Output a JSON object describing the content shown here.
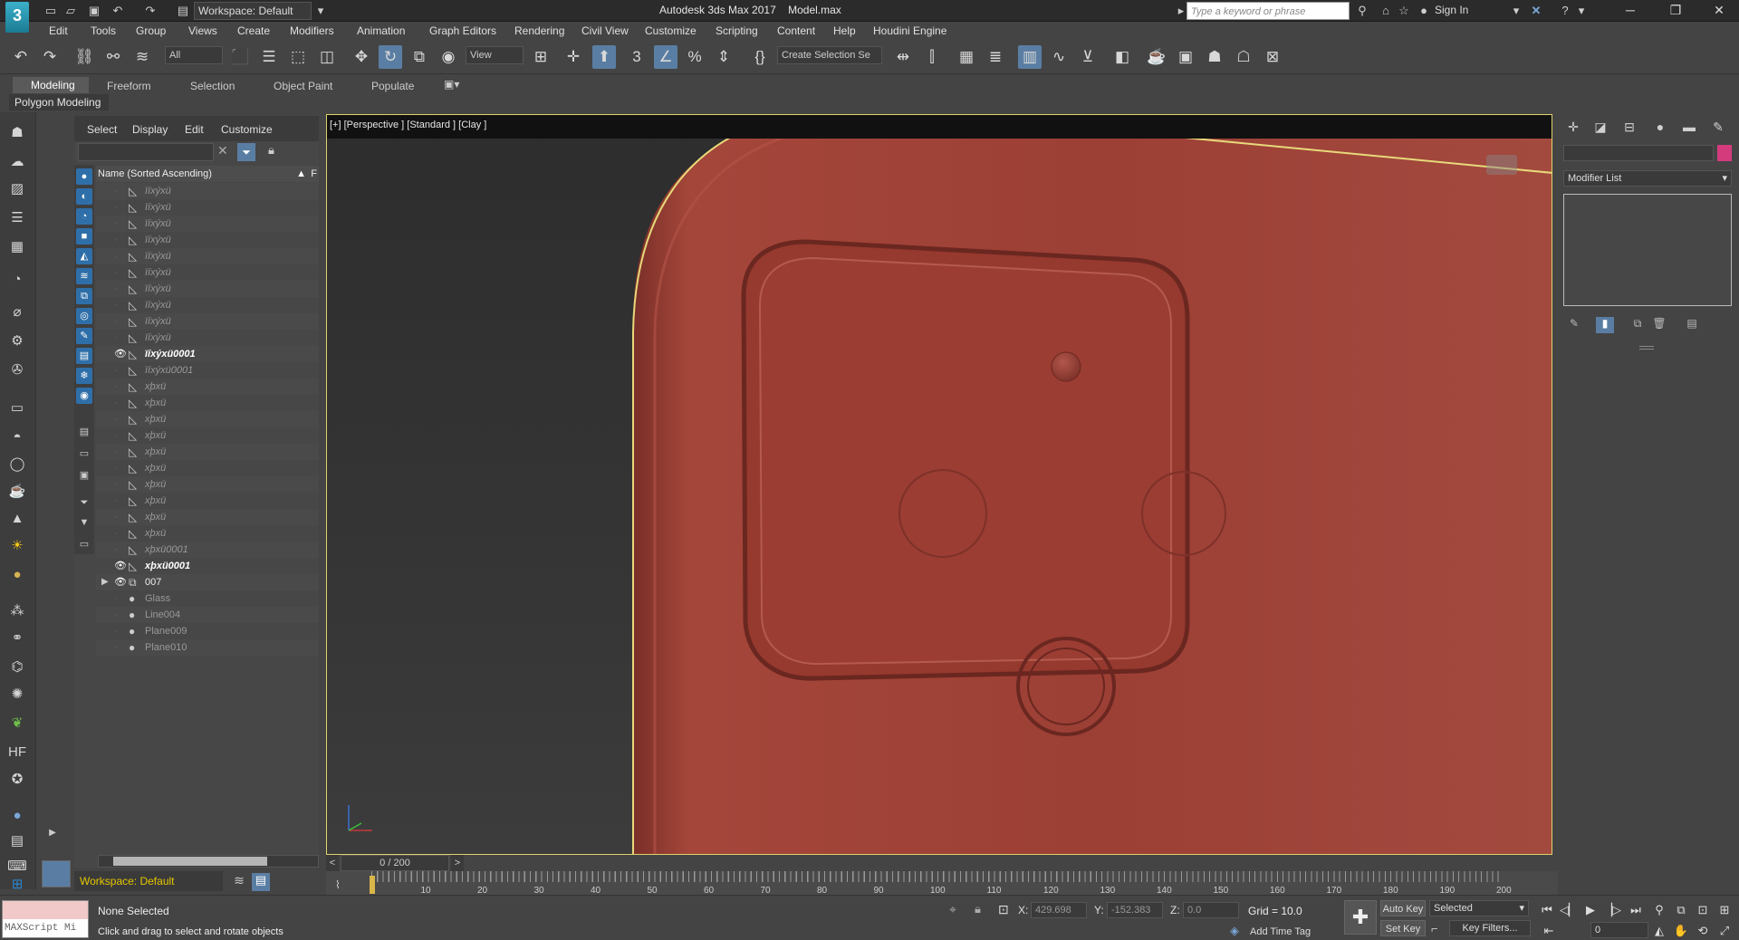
{
  "app": {
    "title": "Autodesk 3ds Max 2017",
    "file": "Model.max",
    "workspace": "Workspace: Default",
    "search_placeholder": "Type a keyword or phrase",
    "signin": "Sign In"
  },
  "menu": [
    "Edit",
    "Tools",
    "Group",
    "Views",
    "Create",
    "Modifiers",
    "Animation",
    "Graph Editors",
    "Rendering",
    "Civil View",
    "Customize",
    "Scripting",
    "Content",
    "Help",
    "Houdini Engine"
  ],
  "toolbar": {
    "selection_filter": "All",
    "reference_coord": "View",
    "named_selection": "Create Selection Se"
  },
  "ribbon": {
    "tabs": [
      "Modeling",
      "Freeform",
      "Selection",
      "Object Paint",
      "Populate"
    ],
    "panel": "Polygon Modeling"
  },
  "explorer": {
    "menu": [
      "Select",
      "Display",
      "Edit",
      "Customize"
    ],
    "column_header": "Name (Sorted Ascending)",
    "column_flag": "F",
    "rows": [
      {
        "label": "ïíxýxü",
        "visible": false
      },
      {
        "label": "ïíxýxü",
        "visible": false
      },
      {
        "label": "ïíxýxü",
        "visible": false
      },
      {
        "label": "ïíxýxü",
        "visible": false
      },
      {
        "label": "ïíxýxü",
        "visible": false
      },
      {
        "label": "ïíxýxü",
        "visible": false
      },
      {
        "label": "ïíxýxü",
        "visible": false
      },
      {
        "label": "ïíxýxü",
        "visible": false
      },
      {
        "label": "ïíxýxü",
        "visible": false
      },
      {
        "label": "ïíxýxü",
        "visible": false
      },
      {
        "label": "ïíxýxü0001",
        "visible": true
      },
      {
        "label": "ïíxýxü0001",
        "visible": false
      },
      {
        "label": "xþxü",
        "visible": false
      },
      {
        "label": "xþxü",
        "visible": false
      },
      {
        "label": "xþxü",
        "visible": false
      },
      {
        "label": "xþxü",
        "visible": false
      },
      {
        "label": "xþxü",
        "visible": false
      },
      {
        "label": "xþxü",
        "visible": false
      },
      {
        "label": "xþxü",
        "visible": false
      },
      {
        "label": "xþxü",
        "visible": false
      },
      {
        "label": "xþxü",
        "visible": false
      },
      {
        "label": "xþxü",
        "visible": false
      },
      {
        "label": "xþxü0001",
        "visible": false
      },
      {
        "label": "xþxü0001",
        "visible": true
      },
      {
        "label": "007",
        "visible": true,
        "group": true
      },
      {
        "label": "Glass",
        "visible": false,
        "plain": true
      },
      {
        "label": "Line004",
        "visible": false,
        "plain": true
      },
      {
        "label": "Plane009",
        "visible": false,
        "plain": true
      },
      {
        "label": "Plane010",
        "visible": false,
        "plain": true
      }
    ],
    "workspace": "Workspace: Default"
  },
  "viewport": {
    "label": "[+] [Perspective ] [Standard ] [Clay ]",
    "model_color": "#9c3f35",
    "selection_color": "#e3d27a"
  },
  "command_panel": {
    "modifier_list": "Modifier List",
    "object_color": "#d43b7d"
  },
  "timeline": {
    "slider": "0 / 200",
    "ticks": [
      0,
      10,
      20,
      30,
      40,
      50,
      60,
      70,
      80,
      90,
      100,
      110,
      120,
      130,
      140,
      150,
      160,
      170,
      180,
      190,
      200
    ]
  },
  "status": {
    "maxscript": "MAXScript Mi",
    "selection": "None Selected",
    "prompt": "Click and drag to select and rotate objects",
    "x_label": "X:",
    "x_value": "429.698",
    "y_label": "Y:",
    "y_value": "-152.383",
    "z_label": "Z:",
    "z_value": "0.0",
    "grid": "Grid = 10.0",
    "add_time_tag": "Add Time Tag",
    "auto_key": "Auto Key",
    "set_key": "Set Key",
    "key_mode": "Selected",
    "key_filters": "Key Filters...",
    "frame": "0"
  }
}
